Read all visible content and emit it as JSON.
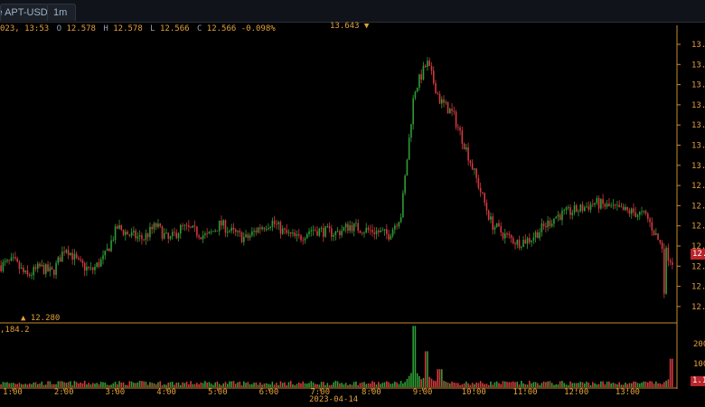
{
  "tabs": {
    "pair": "ce APT-USDT",
    "timeframe": "1m"
  },
  "ohlc": {
    "datetime": "023, 13:53",
    "o_key": "O",
    "o_val": "12.578",
    "h_key": "H",
    "h_val": "12.578",
    "l_key": "L",
    "l_val": "12.566",
    "c_key": "C",
    "c_val": "12.566",
    "change": "-0.098%"
  },
  "annotations": {
    "high_label": "13.643 ▼",
    "low_label": "▲ 12.280",
    "volume_label": ",184.2",
    "date_label": "2023-04-14"
  },
  "price_axis_labels": [
    "13.",
    "13.",
    "13.",
    "13.",
    "13.",
    "13.",
    "13.",
    "12.",
    "12.",
    "12.",
    "12.",
    "12.",
    "12.",
    "12."
  ],
  "price_badge": "12.",
  "volume_axis_labels": [
    "200",
    "100"
  ],
  "volume_badge": "1.1",
  "time_labels": [
    "1:00",
    "2:00",
    "3:00",
    "4:00",
    "5:00",
    "6:00",
    "7:00",
    "8:00",
    "9:00",
    "10:00",
    "11:00",
    "12:00",
    "13:00"
  ],
  "colors": {
    "up": "#2e9e35",
    "down": "#d6383f",
    "text": "#e4a13a",
    "axis": "#c98a2f",
    "background": "#000000"
  },
  "chart_data": {
    "type": "candlestick",
    "x_labels": [
      "1:00",
      "2:00",
      "3:00",
      "4:00",
      "5:00",
      "6:00",
      "7:00",
      "8:00",
      "9:00",
      "10:00",
      "11:00",
      "12:00",
      "13:00"
    ],
    "price_path": [
      [
        0,
        12.48
      ],
      [
        1,
        12.5
      ],
      [
        2,
        12.42
      ],
      [
        3,
        12.47
      ],
      [
        4,
        12.44
      ],
      [
        5,
        12.58
      ],
      [
        6,
        12.49
      ],
      [
        7,
        12.45
      ],
      [
        8,
        12.52
      ],
      [
        9,
        12.68
      ],
      [
        10,
        12.64
      ],
      [
        11,
        12.62
      ],
      [
        12,
        12.69
      ],
      [
        13,
        12.61
      ],
      [
        14,
        12.68
      ],
      [
        15,
        12.66
      ],
      [
        16,
        12.63
      ],
      [
        17,
        12.7
      ],
      [
        18,
        12.65
      ],
      [
        19,
        12.62
      ],
      [
        20,
        12.68
      ],
      [
        21,
        12.71
      ],
      [
        22,
        12.65
      ],
      [
        23,
        12.62
      ],
      [
        24,
        12.67
      ],
      [
        25,
        12.66
      ],
      [
        26,
        12.65
      ],
      [
        27,
        12.69
      ],
      [
        28,
        12.67
      ],
      [
        29,
        12.66
      ],
      [
        30,
        12.64
      ],
      [
        31,
        12.75
      ],
      [
        32,
        13.4
      ],
      [
        33,
        13.55
      ],
      [
        34,
        13.35
      ],
      [
        35,
        13.28
      ],
      [
        36,
        13.1
      ],
      [
        37,
        12.9
      ],
      [
        38,
        12.7
      ],
      [
        39,
        12.64
      ],
      [
        40,
        12.6
      ],
      [
        41,
        12.62
      ],
      [
        42,
        12.68
      ],
      [
        43,
        12.74
      ],
      [
        44,
        12.76
      ],
      [
        45,
        12.78
      ],
      [
        46,
        12.81
      ],
      [
        47,
        12.79
      ],
      [
        48,
        12.77
      ],
      [
        49,
        12.76
      ],
      [
        50,
        12.74
      ],
      [
        51,
        12.6
      ],
      [
        52,
        12.5
      ]
    ],
    "volume_peaks": [
      [
        31,
        10
      ],
      [
        32,
        205
      ],
      [
        33,
        120
      ],
      [
        34,
        60
      ],
      [
        52,
        95
      ]
    ],
    "high": 13.643,
    "low": 12.28,
    "last": 12.566,
    "ylim": [
      12.2,
      13.7
    ]
  }
}
